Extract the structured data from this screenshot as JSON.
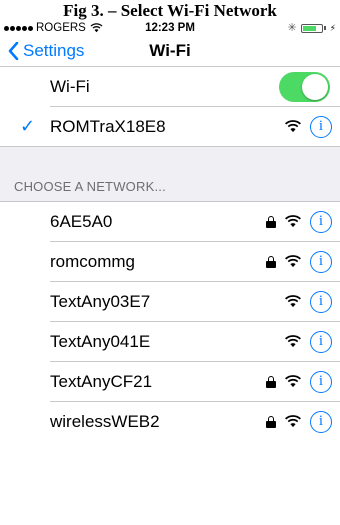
{
  "caption": "Fig 3. – Select Wi-Fi Network",
  "status_bar": {
    "carrier": "ROGERS",
    "time": "12:23 PM"
  },
  "nav": {
    "back_label": "Settings",
    "title": "Wi-Fi"
  },
  "wifi_toggle": {
    "label": "Wi-Fi",
    "on": true
  },
  "connected_network": {
    "name": "ROMTraX18E8",
    "secured": false
  },
  "section_header": "CHOOSE A NETWORK...",
  "networks": [
    {
      "name": "6AE5A0",
      "secured": true
    },
    {
      "name": "romcommg",
      "secured": true
    },
    {
      "name": "TextAny03E7",
      "secured": false
    },
    {
      "name": "TextAny041E",
      "secured": false
    },
    {
      "name": "TextAnyCF21",
      "secured": true
    },
    {
      "name": "wirelessWEB2",
      "secured": true
    }
  ],
  "colors": {
    "accent": "#007aff",
    "toggle_on": "#4cd964",
    "section_bg": "#efeff4"
  }
}
